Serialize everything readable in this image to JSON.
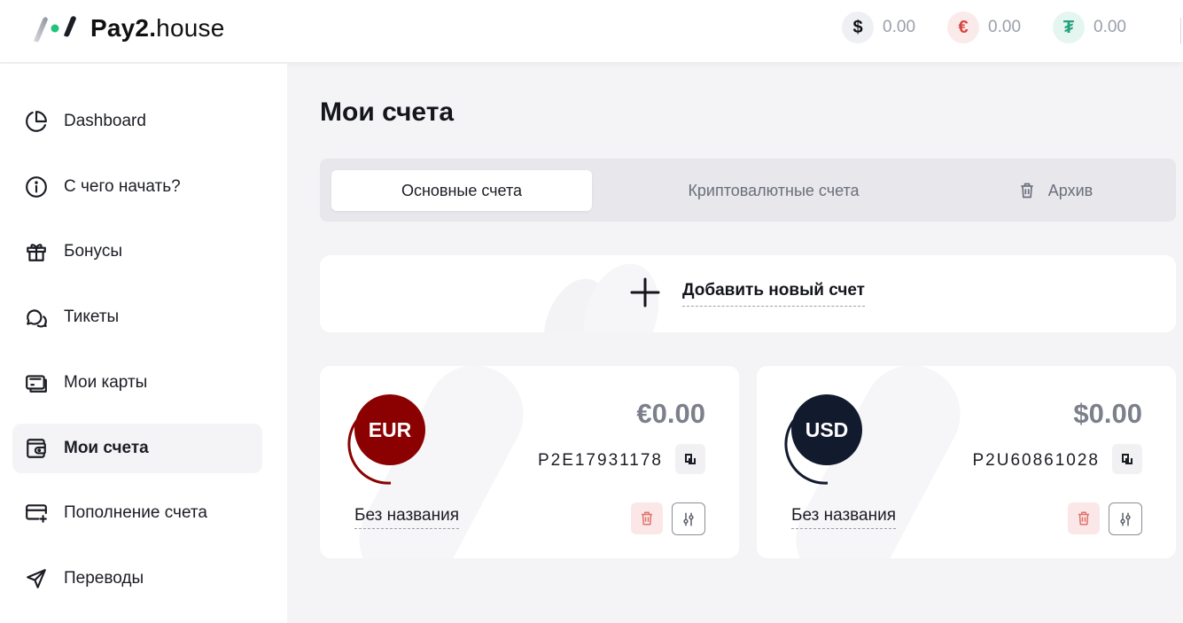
{
  "brand": {
    "name_bold": "Pay2.",
    "name_light": "house"
  },
  "balances": [
    {
      "icon": "dollar-icon",
      "symbol": "$",
      "value": "0.00"
    },
    {
      "icon": "euro-icon",
      "symbol": "€",
      "value": "0.00"
    },
    {
      "icon": "tether-icon",
      "symbol": "₮",
      "value": "0.00"
    }
  ],
  "sidebar": {
    "items": [
      {
        "label": "Dashboard",
        "icon": "pie-chart-icon"
      },
      {
        "label": "С чего начать?",
        "icon": "info-icon"
      },
      {
        "label": "Бонусы",
        "icon": "gift-icon"
      },
      {
        "label": "Тикеты",
        "icon": "chat-icon"
      },
      {
        "label": "Мои карты",
        "icon": "card-icon"
      },
      {
        "label": "Мои счета",
        "icon": "wallet-icon",
        "active": true
      },
      {
        "label": "Пополнение счета",
        "icon": "card-plus-icon"
      },
      {
        "label": "Переводы",
        "icon": "send-icon"
      }
    ]
  },
  "main": {
    "title": "Мои счета",
    "tabs": [
      {
        "label": "Основные счета",
        "active": true
      },
      {
        "label": "Криптовалютные счета"
      },
      {
        "label": "Архив",
        "icon": "trash-icon"
      }
    ],
    "add_account_label": "Добавить новый счет",
    "accounts": [
      {
        "currency": "EUR",
        "amount": "€0.00",
        "number": "P2E17931178",
        "name": "Без названия",
        "color": "#8b0000"
      },
      {
        "currency": "USD",
        "amount": "$0.00",
        "number": "P2U60861028",
        "name": "Без названия",
        "color": "#121a2e"
      }
    ]
  }
}
